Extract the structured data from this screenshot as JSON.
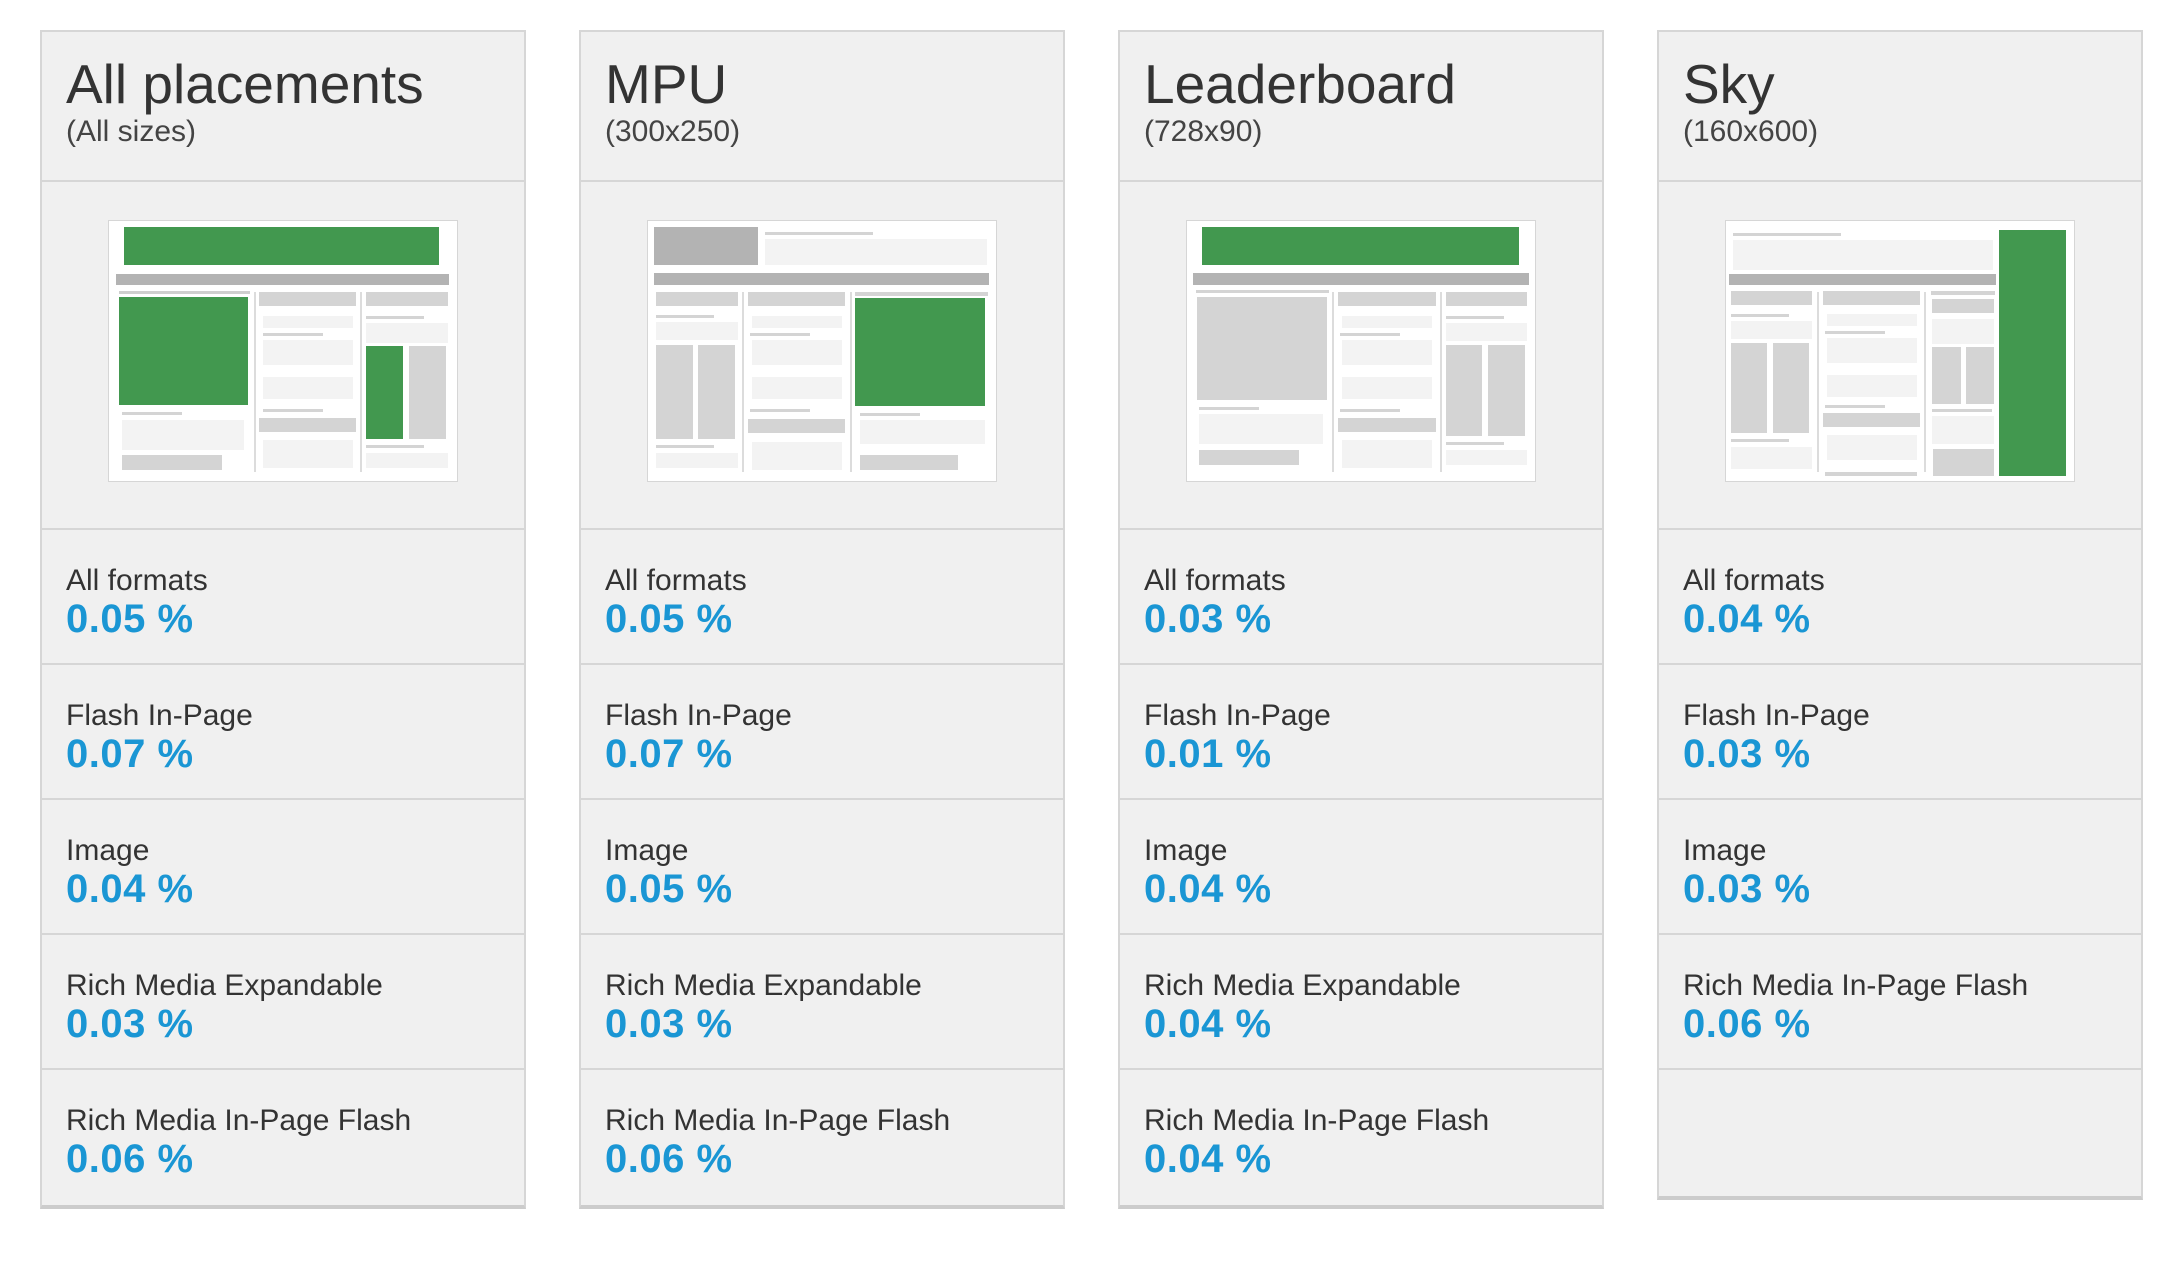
{
  "colors": {
    "accent_value": "#1a96d4",
    "ad_green": "#42984f",
    "placeholder_dark": "#b3b3b3",
    "placeholder_light": "#d4d4d4"
  },
  "cards": [
    {
      "title": "All placements",
      "subtitle": "(All sizes)",
      "preview_icon": "all-placements-wireframe-icon",
      "stats": [
        {
          "label": "All formats",
          "value": "0.05 %"
        },
        {
          "label": "Flash In-Page",
          "value": "0.07 %"
        },
        {
          "label": "Image",
          "value": "0.04 %"
        },
        {
          "label": "Rich Media Expandable",
          "value": "0.03 %"
        },
        {
          "label": "Rich Media In-Page Flash",
          "value": "0.06 %"
        }
      ]
    },
    {
      "title": "MPU",
      "subtitle": "(300x250)",
      "preview_icon": "mpu-wireframe-icon",
      "stats": [
        {
          "label": "All formats",
          "value": "0.05 %"
        },
        {
          "label": "Flash In-Page",
          "value": "0.07 %"
        },
        {
          "label": "Image",
          "value": "0.05 %"
        },
        {
          "label": "Rich Media Expandable",
          "value": "0.03 %"
        },
        {
          "label": "Rich Media In-Page Flash",
          "value": "0.06 %"
        }
      ]
    },
    {
      "title": "Leaderboard",
      "subtitle": "(728x90)",
      "preview_icon": "leaderboard-wireframe-icon",
      "stats": [
        {
          "label": "All formats",
          "value": "0.03 %"
        },
        {
          "label": "Flash In-Page",
          "value": "0.01 %"
        },
        {
          "label": "Image",
          "value": "0.04 %"
        },
        {
          "label": "Rich Media Expandable",
          "value": "0.04 %"
        },
        {
          "label": "Rich Media In-Page Flash",
          "value": "0.04 %"
        }
      ]
    },
    {
      "title": "Sky",
      "subtitle": "(160x600)",
      "preview_icon": "sky-wireframe-icon",
      "stats": [
        {
          "label": "All formats",
          "value": "0.04 %"
        },
        {
          "label": "Flash In-Page",
          "value": "0.03 %"
        },
        {
          "label": "Image",
          "value": "0.03 %"
        },
        {
          "label": "Rich Media In-Page Flash",
          "value": "0.06 %"
        }
      ]
    }
  ]
}
